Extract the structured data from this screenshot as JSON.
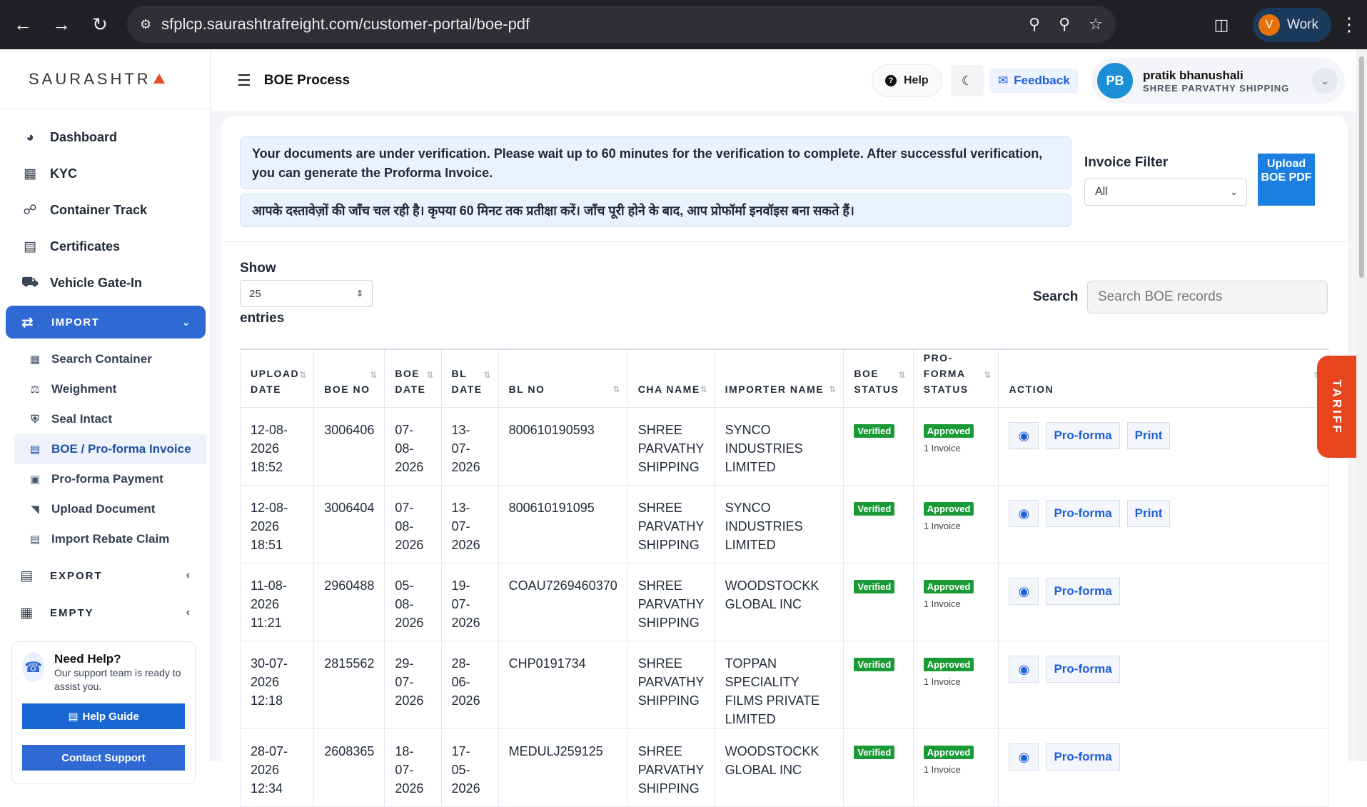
{
  "browser": {
    "url": "sfplcp.saurashtrafreight.com/customer-portal/boe-pdf",
    "profile_initial": "V",
    "profile_label": "Work"
  },
  "sidebar": {
    "logo": "SAURASHTR",
    "items": [
      {
        "label": "Dashboard",
        "icon": "dashboard-icon"
      },
      {
        "label": "KYC",
        "icon": "kyc-icon"
      },
      {
        "label": "Container Track",
        "icon": "container-track-icon"
      },
      {
        "label": "Certificates",
        "icon": "certificates-icon"
      },
      {
        "label": "Vehicle Gate-In",
        "icon": "truck-icon"
      }
    ],
    "import_label": "IMPORT",
    "import_items": [
      {
        "label": "Search Container"
      },
      {
        "label": "Weighment"
      },
      {
        "label": "Seal Intact"
      },
      {
        "label": "BOE / Pro-forma Invoice"
      },
      {
        "label": "Pro-forma Payment"
      },
      {
        "label": "Upload Document"
      },
      {
        "label": "Import Rebate Claim"
      }
    ],
    "export_label": "EXPORT",
    "empty_label": "EMPTY",
    "help": {
      "title": "Need Help?",
      "subtitle": "Our support team is ready to assist you.",
      "guide_label": "Help Guide",
      "contact_label": "Contact Support"
    }
  },
  "header": {
    "title": "BOE Process",
    "help_label": "Help",
    "feedback_label": "Feedback",
    "user_initials": "PB",
    "user_name": "pratik bhanushali",
    "user_org": "SHREE PARVATHY SHIPPING"
  },
  "notice": {
    "english": "Your documents are under verification. Please wait up to 60 minutes for the verification to complete. After successful verification, you can generate the Proforma Invoice.",
    "hindi": "आपके दस्तावेज़ों की जाँच चल रही है। कृपया 60 मिनट तक प्रतीक्षा करें। जाँच पूरी होने के बाद, आप प्रोफॉर्मा इनवॉइस बना सकते हैं।"
  },
  "filter": {
    "label": "Invoice Filter",
    "selected": "All",
    "upload_label": "Upload BOE PDF"
  },
  "table_controls": {
    "show_label": "Show",
    "entries_value": "25",
    "entries_label": "entries",
    "search_label": "Search",
    "search_placeholder": "Search BOE records"
  },
  "table": {
    "headers": [
      "UPLOAD DATE",
      "BOE NO",
      "BOE DATE",
      "BL DATE",
      "BL NO",
      "CHA NAME",
      "IMPORTER NAME",
      "BOE STATUS",
      "PRO-FORMA STATUS",
      "ACTION"
    ],
    "action_proforma": "Pro-forma",
    "action_print": "Print",
    "rows": [
      {
        "upload_date": "12-08-2026 18:52",
        "boe_no": "3006406",
        "boe_date": "07-08-2026",
        "bl_date": "13-07-2026",
        "bl_no": "800610190593",
        "cha_name": "SHREE PARVATHY SHIPPING",
        "importer": "SYNCO INDUSTRIES LIMITED",
        "boe_status": "Verified",
        "pf_status": "Approved",
        "pf_invoices": "1 Invoice",
        "print": true
      },
      {
        "upload_date": "12-08-2026 18:51",
        "boe_no": "3006404",
        "boe_date": "07-08-2026",
        "bl_date": "13-07-2026",
        "bl_no": "800610191095",
        "cha_name": "SHREE PARVATHY SHIPPING",
        "importer": "SYNCO INDUSTRIES LIMITED",
        "boe_status": "Verified",
        "pf_status": "Approved",
        "pf_invoices": "1 Invoice",
        "print": true
      },
      {
        "upload_date": "11-08-2026 11:21",
        "boe_no": "2960488",
        "boe_date": "05-08-2026",
        "bl_date": "19-07-2026",
        "bl_no": "COAU7269460370",
        "cha_name": "SHREE PARVATHY SHIPPING",
        "importer": "WOODSTOCKK GLOBAL INC",
        "boe_status": "Verified",
        "pf_status": "Approved",
        "pf_invoices": "1 Invoice",
        "print": false
      },
      {
        "upload_date": "30-07-2026 12:18",
        "boe_no": "2815562",
        "boe_date": "29-07-2026",
        "bl_date": "28-06-2026",
        "bl_no": "CHP0191734",
        "cha_name": "SHREE PARVATHY SHIPPING",
        "importer": "TOPPAN SPECIALITY FILMS PRIVATE LIMITED",
        "boe_status": "Verified",
        "pf_status": "Approved",
        "pf_invoices": "1 Invoice",
        "print": false
      },
      {
        "upload_date": "28-07-2026 12:34",
        "boe_no": "2608365",
        "boe_date": "18-07-2026",
        "bl_date": "17-05-2026",
        "bl_no": "MEDULJ259125",
        "cha_name": "SHREE PARVATHY SHIPPING",
        "importer": "WOODSTOCKK GLOBAL INC",
        "boe_status": "Verified",
        "pf_status": "Approved",
        "pf_invoices": "1 Invoice",
        "print": false
      }
    ]
  },
  "tariff_label": "TARIFF",
  "colors": {
    "accent": "#2f6ad4",
    "verified": "#1a9a37",
    "tariff": "#e8451e"
  }
}
